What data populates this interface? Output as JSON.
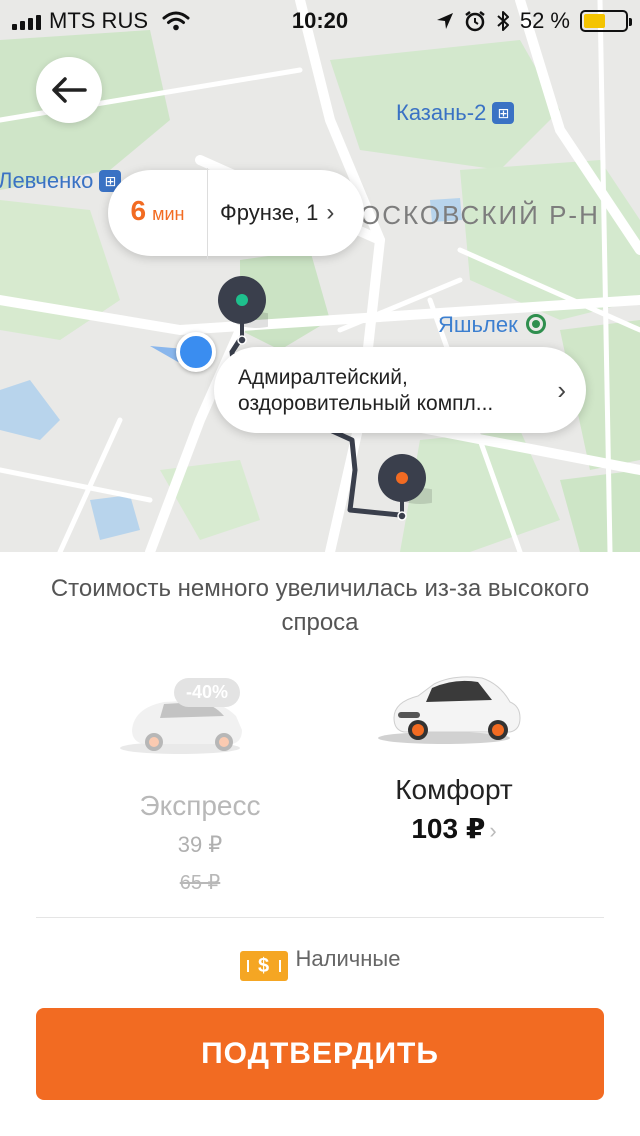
{
  "status_bar": {
    "carrier": "MTS RUS",
    "time": "10:20",
    "battery_percent": "52 %",
    "battery_level": 0.52
  },
  "map": {
    "labels": {
      "station_kazan": "Казань-2",
      "station_levchenko": "Левченко",
      "district": "ОСКОВСКИЙ Р-Н",
      "station_yashlek": "Яшьлек"
    },
    "eta": {
      "value": "6",
      "unit": "мин",
      "address": "Фрунзе, 1"
    },
    "destination": {
      "line1": "Адмиралтейский,",
      "line2": "оздоровительный компл..."
    }
  },
  "sheet": {
    "notice": "Стоимость немного увеличилась из-за высокого спроса",
    "tariffs": [
      {
        "name": "Экспресс",
        "price": "39 ₽",
        "old_price": "65 ₽",
        "discount": "-40%"
      },
      {
        "name": "Комфорт",
        "price": "103 ₽"
      }
    ],
    "payment": {
      "icon_label": "$",
      "label": "Наличные"
    },
    "confirm_label": "ПОДТВЕРДИТЬ"
  },
  "colors": {
    "accent": "#f26b22",
    "user_dot": "#3a8df0",
    "cash": "#f5a623"
  }
}
